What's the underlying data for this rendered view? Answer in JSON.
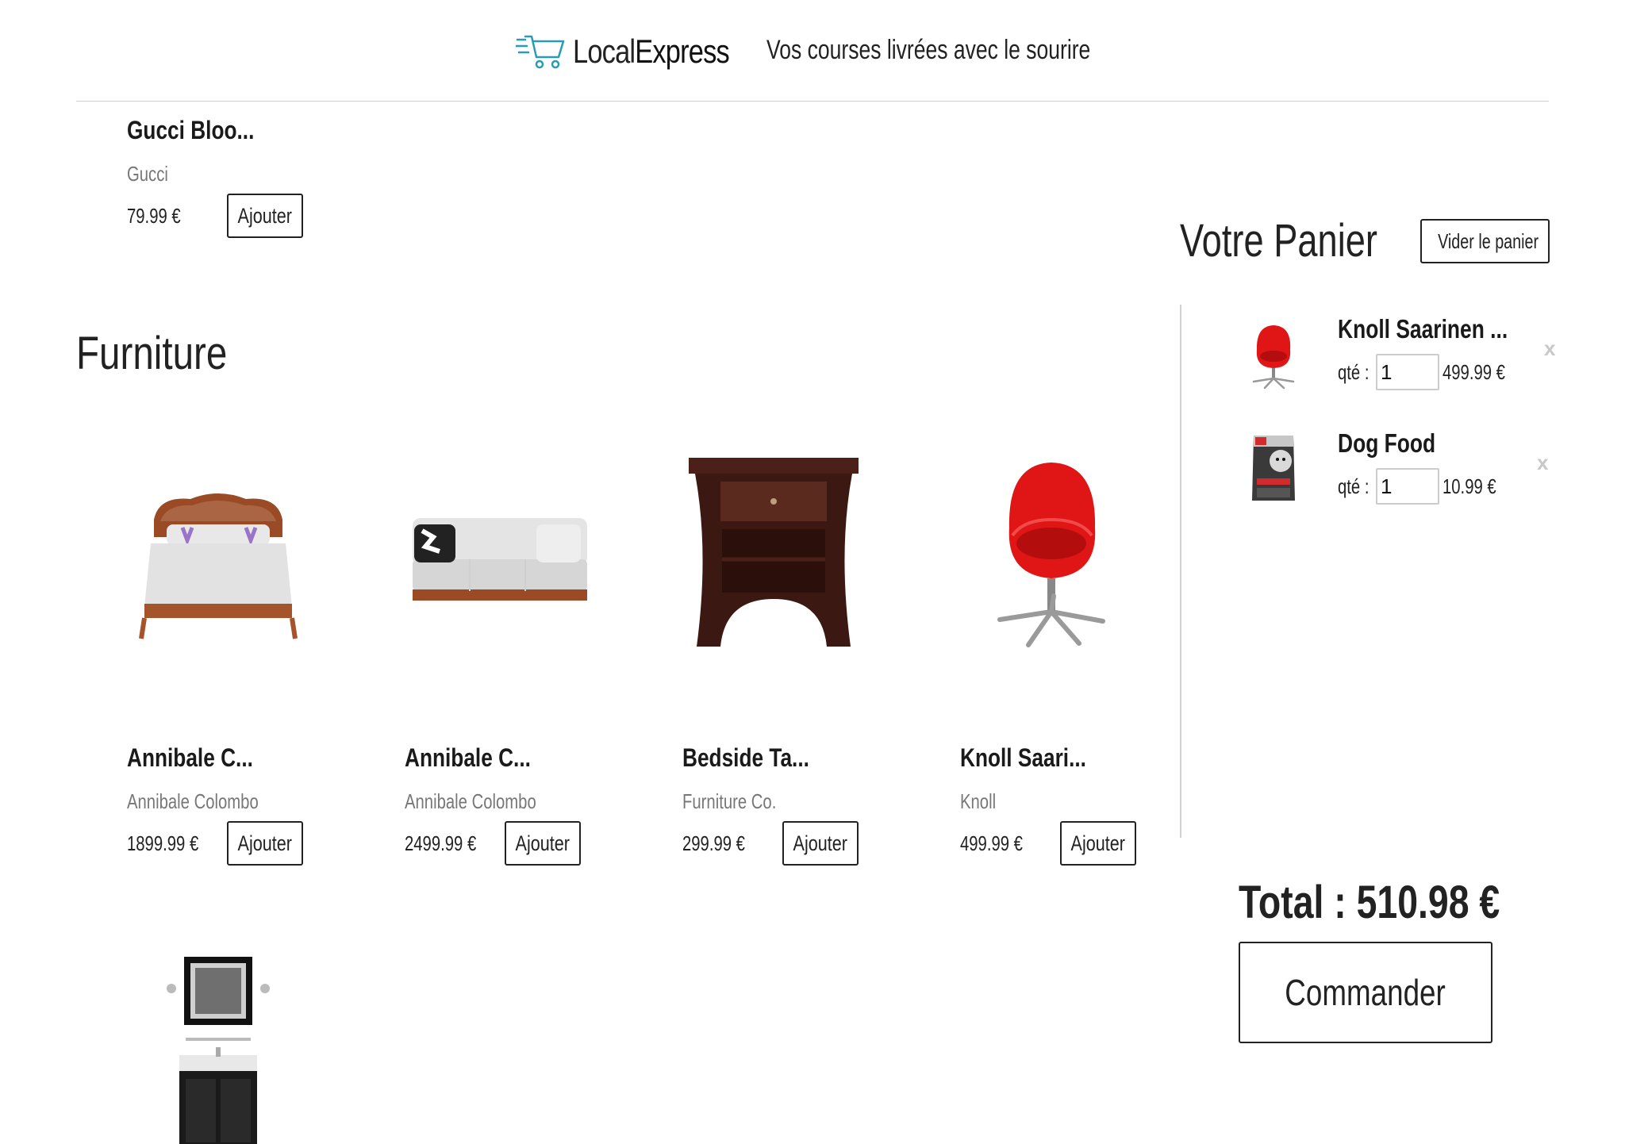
{
  "header": {
    "brand_light": "Local",
    "brand_bold": "Express",
    "tagline": "Vos courses livrées avec le sourire"
  },
  "top_product": {
    "name": "Gucci Bloo...",
    "maker": "Gucci",
    "price": "79.99 €",
    "add_label": "Ajouter"
  },
  "section": {
    "title": "Furniture"
  },
  "products": [
    {
      "name": "Annibale C...",
      "maker": "Annibale Colombo",
      "price": "1899.99 €",
      "add_label": "Ajouter",
      "image": "bed"
    },
    {
      "name": "Annibale C...",
      "maker": "Annibale Colombo",
      "price": "2499.99 €",
      "add_label": "Ajouter",
      "image": "sofa"
    },
    {
      "name": "Bedside Ta...",
      "maker": "Furniture Co.",
      "price": "299.99 €",
      "add_label": "Ajouter",
      "image": "bedside-table"
    },
    {
      "name": "Knoll Saari...",
      "maker": "Knoll",
      "price": "499.99 €",
      "add_label": "Ajouter",
      "image": "red-chair"
    }
  ],
  "next_row_product": {
    "image": "bathroom-vanity"
  },
  "cart": {
    "title": "Votre Panier",
    "clear_label": "Vider le panier",
    "qty_label": "qté :",
    "items": [
      {
        "name": "Knoll Saarinen ...",
        "qty": "1",
        "price": "499.99 €",
        "remove": "x",
        "image": "red-chair"
      },
      {
        "name": "Dog Food",
        "qty": "1",
        "price": "10.99 €",
        "remove": "x",
        "image": "dog-food-bag"
      }
    ],
    "total": "Total : 510.98 €",
    "order_label": "Commander"
  },
  "colors": {
    "logo_accent": "#2a9bb5",
    "text": "#222222",
    "muted": "#777777",
    "rule": "#cfcfcf",
    "chair_red": "#e01515"
  }
}
